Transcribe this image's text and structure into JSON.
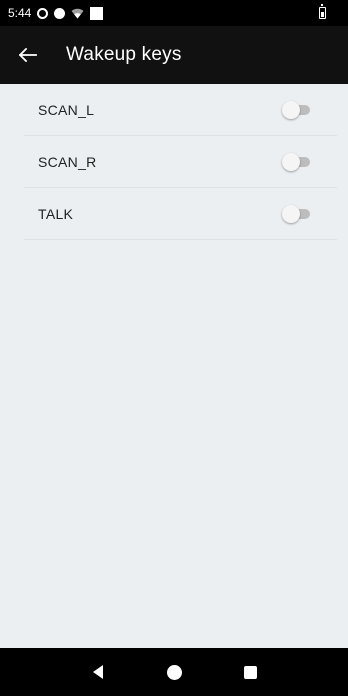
{
  "status_bar": {
    "time": "5:44",
    "icons": [
      "sync-icon",
      "circle-icon",
      "wifi-icon",
      "square-icon",
      "battery-icon"
    ]
  },
  "app_bar": {
    "title": "Wakeup keys",
    "back_icon": "arrow-left-icon"
  },
  "list": {
    "items": [
      {
        "label": "SCAN_L",
        "checked": false
      },
      {
        "label": "SCAN_R",
        "checked": false
      },
      {
        "label": "TALK",
        "checked": false
      }
    ]
  },
  "nav_bar": {
    "buttons": [
      "back-triangle-icon",
      "home-circle-icon",
      "recents-square-icon"
    ]
  },
  "colors": {
    "background": "#ebeff2",
    "app_bar": "#111111",
    "status_bar": "#000000",
    "switch_track_off": "#bdbdbd",
    "switch_thumb_off": "#f5f5f5"
  }
}
